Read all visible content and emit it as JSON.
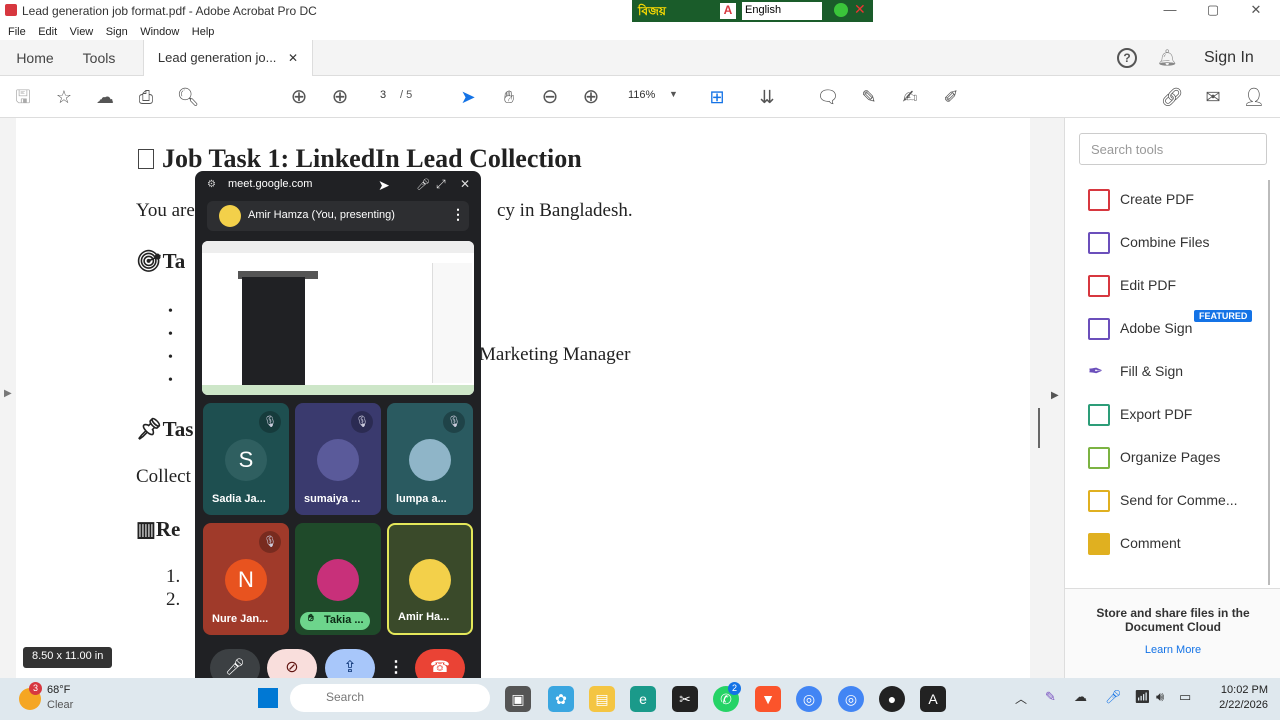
{
  "window": {
    "title": "Lead generation job format.pdf - Adobe Acrobat Pro DC"
  },
  "ime": {
    "brand": "বিজয়",
    "language": "English"
  },
  "menu": [
    "File",
    "Edit",
    "View",
    "Sign",
    "Window",
    "Help"
  ],
  "tabs": {
    "home": "Home",
    "tools": "Tools",
    "doc": "Lead generation jo...",
    "signin": "Sign In"
  },
  "toolbar": {
    "page_current": "3",
    "page_total": "/ 5",
    "zoom": "116%"
  },
  "document": {
    "heading": "Job Task 1: LinkedIn Lead Collection",
    "line1_start": "You are",
    "line1_end": "cy in Bangladesh.",
    "sec2": "Ta",
    "bullet3_end": "Marketing Manager",
    "sec3": "Tas",
    "collect": "Collect",
    "sec4": "Re",
    "num1": "1.",
    "num2": "2.",
    "page_size": "8.50 x 11.00 in"
  },
  "right_panel": {
    "search_placeholder": "Search tools",
    "tools": [
      {
        "label": "Create PDF",
        "color": "#d7373f"
      },
      {
        "label": "Combine Files",
        "color": "#6b4fbb"
      },
      {
        "label": "Edit PDF",
        "color": "#d7373f"
      },
      {
        "label": "Adobe Sign",
        "color": "#6b4fbb"
      },
      {
        "label": "Fill & Sign",
        "color": "#6b4fbb"
      },
      {
        "label": "Export PDF",
        "color": "#2d9d78"
      },
      {
        "label": "Organize Pages",
        "color": "#7cb342"
      },
      {
        "label": "Send for Comme...",
        "color": "#e0b020"
      },
      {
        "label": "Comment",
        "color": "#e0b020"
      }
    ],
    "featured_badge": "FEATURED",
    "cloud_text": "Store and share files in the Document Cloud",
    "learn_more": "Learn More"
  },
  "meet": {
    "url": "meet.google.com",
    "presenter": "Amir Hamza (You, presenting)",
    "participants": [
      {
        "name": "Sadia Ja...",
        "initial": "S",
        "bg": "#1e4f50",
        "avbg": "#2f5f60",
        "muted": true
      },
      {
        "name": "sumaiya ...",
        "initial": "",
        "bg": "#3a3a6e",
        "avbg": "#5a5a9a",
        "muted": true
      },
      {
        "name": "lumpa a...",
        "initial": "",
        "bg": "#2a5a60",
        "avbg": "#8fb5c8",
        "muted": true
      },
      {
        "name": "Nure Jan...",
        "initial": "N",
        "bg": "#a03a2a",
        "avbg": "#e8531f",
        "muted": true
      },
      {
        "name": "Takia ...",
        "initial": "",
        "bg": "#1f4a2a",
        "avbg": "#c8307a",
        "muted": false
      },
      {
        "name": "Amir Ha...",
        "initial": "",
        "bg": "#3a4a2a",
        "avbg": "#f3d04a",
        "muted": false
      }
    ]
  },
  "taskbar": {
    "weather_temp": "68°F",
    "weather_cond": "Clear",
    "weather_badge": "3",
    "search": "Search",
    "whatsapp_badge": "2",
    "time": "10:02 PM",
    "date": "2/22/2026"
  },
  "colors": {
    "accent": "#1473e6",
    "meet_bg": "#202124",
    "end_call": "#ea4335"
  }
}
